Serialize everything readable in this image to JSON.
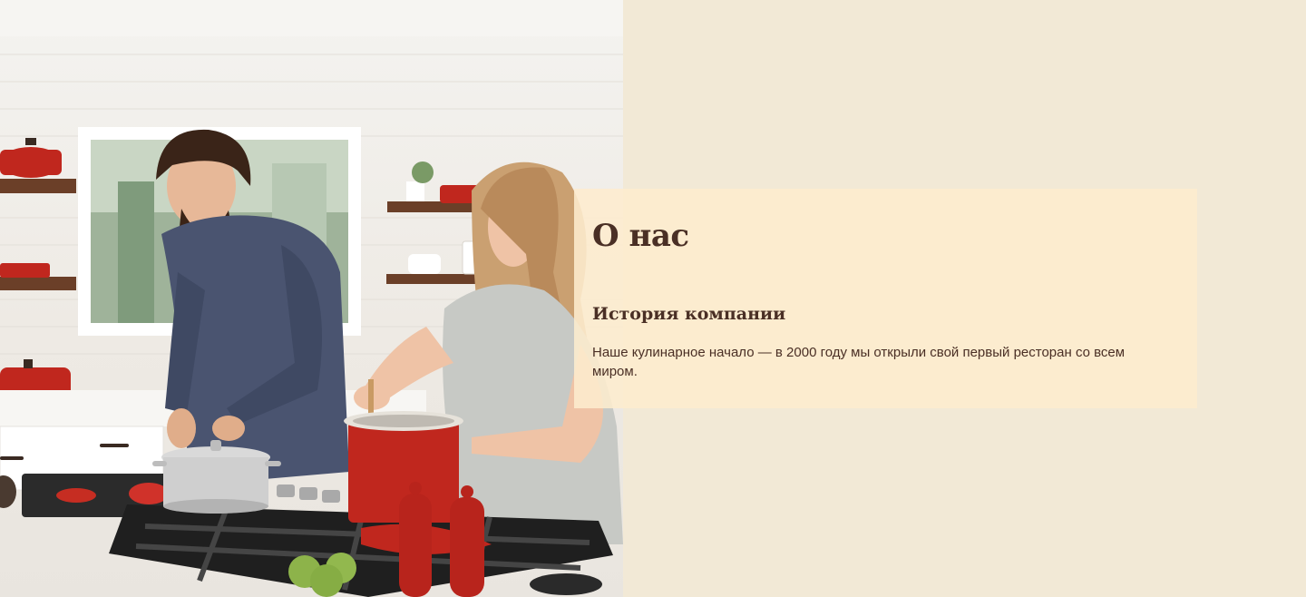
{
  "about": {
    "title": "О нас",
    "subtitle": "История компании",
    "text": "Наше кулинарное начало — в 2000 году мы открыли свой первый ресторан со всем миром."
  },
  "hero_image": {
    "icon": "kitchen-couple-photo"
  },
  "colors": {
    "page_background": "#f2e9d6",
    "card_background": "#fdecce",
    "text": "#4a2f25",
    "accent_red": "#c0271e"
  }
}
